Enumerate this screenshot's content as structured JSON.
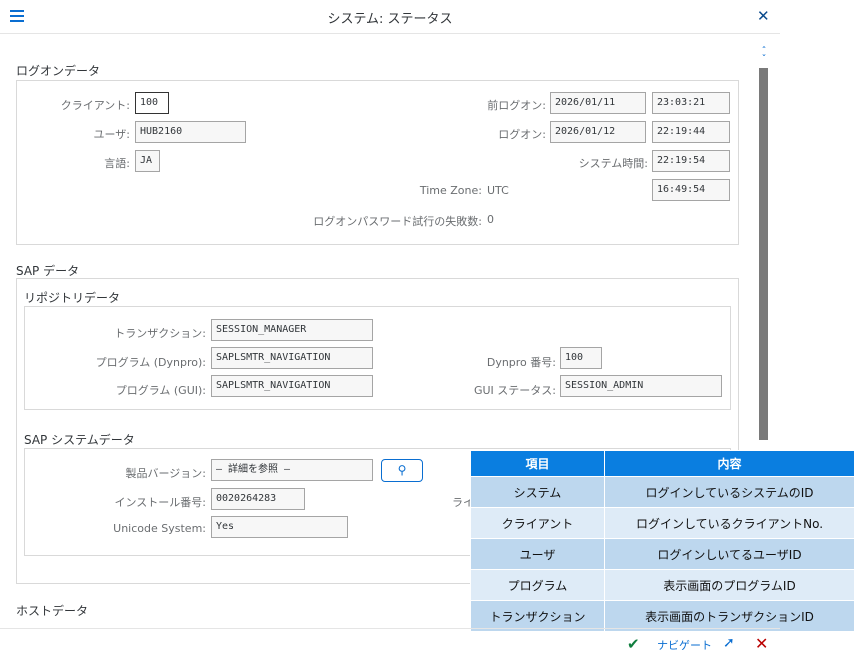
{
  "header": {
    "title": "システム: ステータス"
  },
  "icons": {
    "menu": "hamburger-icon",
    "close": "close-icon",
    "help": "value-help-icon",
    "confirm": "check-icon",
    "open": "open-window-icon",
    "cancel": "cancel-icon"
  },
  "logon": {
    "title": "ログオンデータ",
    "client_label": "クライアント:",
    "client_value": "100",
    "user_label": "ユーザ:",
    "user_value": "HUB2160",
    "language_label": "言語:",
    "language_value": "JA",
    "prev_logon_label": "前ログオン:",
    "prev_logon_date": "2026/01/11",
    "prev_logon_time": "23:03:21",
    "logon_label": "ログオン:",
    "logon_date": "2026/01/12",
    "logon_time": "22:19:44",
    "system_time_label": "システム時間:",
    "system_time_value": "22:19:54",
    "timezone_label": "Time Zone:",
    "timezone_value": "UTC",
    "timezone_time": "16:49:54",
    "failed_label": "ログオンパスワード試行の失敗数:",
    "failed_value": "0"
  },
  "sap_data": {
    "title": "SAP データ",
    "repo_title": "リポジトリデータ",
    "transaction_label": "トランザクション:",
    "transaction_value": "SESSION_MANAGER",
    "program_dynpro_label": "プログラム (Dynpro):",
    "program_dynpro_value": "SAPLSMTR_NAVIGATION",
    "dynpro_no_label": "Dynpro 番号:",
    "dynpro_no_value": "100",
    "program_gui_label": "プログラム (GUI):",
    "program_gui_value": "SAPLSMTR_NAVIGATION",
    "gui_status_label": "GUI ステータス:",
    "gui_status_value": "SESSION_ADMIN",
    "sys_title": "SAP システムデータ",
    "product_label": "製品バージョン:",
    "product_value": "– 詳細を参照 –",
    "install_label": "インストール番号:",
    "install_value": "0020264283",
    "license_label_partial": "ライ",
    "unicode_label": "Unicode System:",
    "unicode_value": "Yes"
  },
  "host": {
    "title": "ホストデータ"
  },
  "overlay": {
    "headers": [
      "項目",
      "内容"
    ],
    "rows": [
      [
        "システム",
        "ログインしているシステムのID"
      ],
      [
        "クライアント",
        "ログインしているクライアントNo."
      ],
      [
        "ユーザ",
        "ログインしいてるユーザID"
      ],
      [
        "プログラム",
        "表示画面のプログラムID"
      ],
      [
        "トランザクション",
        "表示画面のトランザクションID"
      ]
    ]
  },
  "footer": {
    "navigate_label": "ナビゲート"
  }
}
